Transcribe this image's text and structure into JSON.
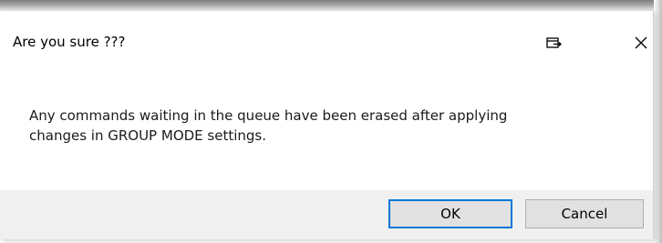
{
  "dialog": {
    "title": "Are you sure ???",
    "restore_icon": "restore-window-icon",
    "close_icon": "close-icon",
    "message_lines": [
      "Any commands waiting in the queue have been erased after applying",
      "changes in GROUP MODE settings."
    ],
    "buttons": {
      "ok_label": "OK",
      "cancel_label": "Cancel"
    },
    "colors": {
      "default_button_border": "#0078d7",
      "footer_background": "#f0f0f0",
      "button_background": "#e1e1e1"
    }
  }
}
